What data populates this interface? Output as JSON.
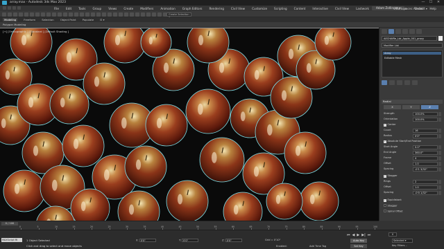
{
  "window": {
    "title": "array.max - Autodesk 3ds Max 2023",
    "min_glyph": "—",
    "max_glyph": "☐",
    "close_glyph": "✕"
  },
  "menu": {
    "items": [
      "File",
      "Edit",
      "Tools",
      "Group",
      "Views",
      "Create",
      "Modifiers",
      "Animation",
      "Graph Editors",
      "Rendering",
      "Civil View",
      "Customize",
      "Scripting",
      "Content",
      "Interactive",
      "Civil View",
      "Lastwork",
      "V-Ray",
      "Substance",
      "Arnold",
      "Help"
    ],
    "user": "Adam Zollinger ▾",
    "workspaces_label": "Workspaces:",
    "workspace_value": "Default ▾"
  },
  "toolbar": {
    "selection_set_placeholder": "Create Selection Se ▾"
  },
  "ribbon": {
    "tabs": [
      "Modeling",
      "Freeform",
      "Selection",
      "Object Paint",
      "Populate",
      "⊡ ▾"
    ],
    "active_tab": 0,
    "subribbon_label": "Polygon Modeling"
  },
  "viewport": {
    "label": "[+] [Orthographic ] [Standard ] [Default Shading ]",
    "bg_color": "#0a0a0a",
    "highlight_color": "#7ee3ec"
  },
  "command_panel": {
    "object_name": "AECHAffle_Ldr_Apple_001_proxy",
    "modifier_list": "Modifier List",
    "stack": [
      "Array",
      "Editable Mesh"
    ],
    "rollout_title": "Radial",
    "axes": [
      "X",
      "Y",
      "Z"
    ],
    "active_axis": 2,
    "params_top": [
      {
        "label": "Strength",
        "value": "100.0%"
      },
      {
        "label": "Orientation",
        "value": "100.0%"
      }
    ],
    "center_label": "Center",
    "params_center": [
      {
        "label": "Count",
        "value": "16"
      },
      {
        "label": "Radius",
        "value": "0'0\""
      }
    ],
    "absolute_label": "Absolute Start/End Position",
    "params_angle": [
      {
        "label": "Start Angle",
        "value": "0.0°"
      },
      {
        "label": "End Angle",
        "value": "360.0°"
      },
      {
        "label": "Frame",
        "value": "4"
      },
      {
        "label": "Offset",
        "value": "1.0"
      },
      {
        "label": "Spacing",
        "value": "-0'1 3/32\""
      }
    ],
    "stagger_label": "Stagger",
    "params_stagger": [
      {
        "label": "Rings",
        "value": "2"
      },
      {
        "label": "Offset",
        "value": "1.0"
      },
      {
        "label": "Spacing",
        "value": "-0'0 1/32\""
      }
    ],
    "equidistant_label": "Equidistant",
    "stagger2_label": "Stagger",
    "spiral_label": "Spiral Offset"
  },
  "timeline": {
    "frame_slider": "0 / 100",
    "ticks": [
      "0",
      "5",
      "10",
      "15",
      "20",
      "25",
      "30",
      "35",
      "40",
      "45",
      "50",
      "55",
      "60",
      "65",
      "70",
      "75",
      "80",
      "85",
      "90",
      "95",
      "100"
    ]
  },
  "status": {
    "maxscript": "MAXScript Mi",
    "object_selected": "1 Object Selected",
    "prompt": "Click and drag to select and move objects",
    "x_label": "X:",
    "x_value": "0'0\"",
    "y_label": "Y:",
    "y_value": "0'0\"",
    "z_label": "Z:",
    "z_value": "0'0\"",
    "grid": "Grid = 0'10\"",
    "enabled": "Enabled: ",
    "add_time_tag": "Add Time Tag",
    "auto_key": "Auto Key",
    "set_key": "Set Key",
    "selected": "Selected ▾",
    "key_filters": "Key Filters...",
    "current_frame": "0",
    "play_controls": [
      "⏮",
      "◀",
      "▶",
      "▶|",
      "⏭"
    ]
  }
}
